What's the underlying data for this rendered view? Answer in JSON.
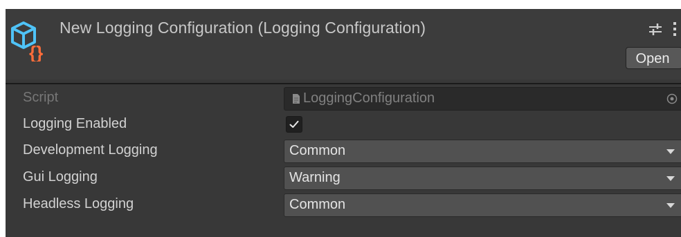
{
  "header": {
    "title": "New Logging Configuration (Logging Configuration)",
    "open_label": "Open",
    "icons": {
      "asset": "scriptable-object-icon",
      "settings": "sliders-icon",
      "more": "kebab-menu-icon"
    }
  },
  "properties": [
    {
      "label": "Script",
      "type": "object",
      "value": "LoggingConfiguration",
      "disabled": true
    },
    {
      "label": "Logging Enabled",
      "type": "toggle",
      "checked": true
    },
    {
      "label": "Development Logging",
      "type": "dropdown",
      "value": "Common"
    },
    {
      "label": "Gui Logging",
      "type": "dropdown",
      "value": "Warning"
    },
    {
      "label": "Headless Logging",
      "type": "dropdown",
      "value": "Common"
    }
  ],
  "colors": {
    "background": "#383838",
    "header": "#3c3c3c",
    "icon_blue": "#4fc3f7",
    "icon_orange": "#ff6d3a",
    "text": "#d2d2d2",
    "text_disabled": "#777777"
  }
}
